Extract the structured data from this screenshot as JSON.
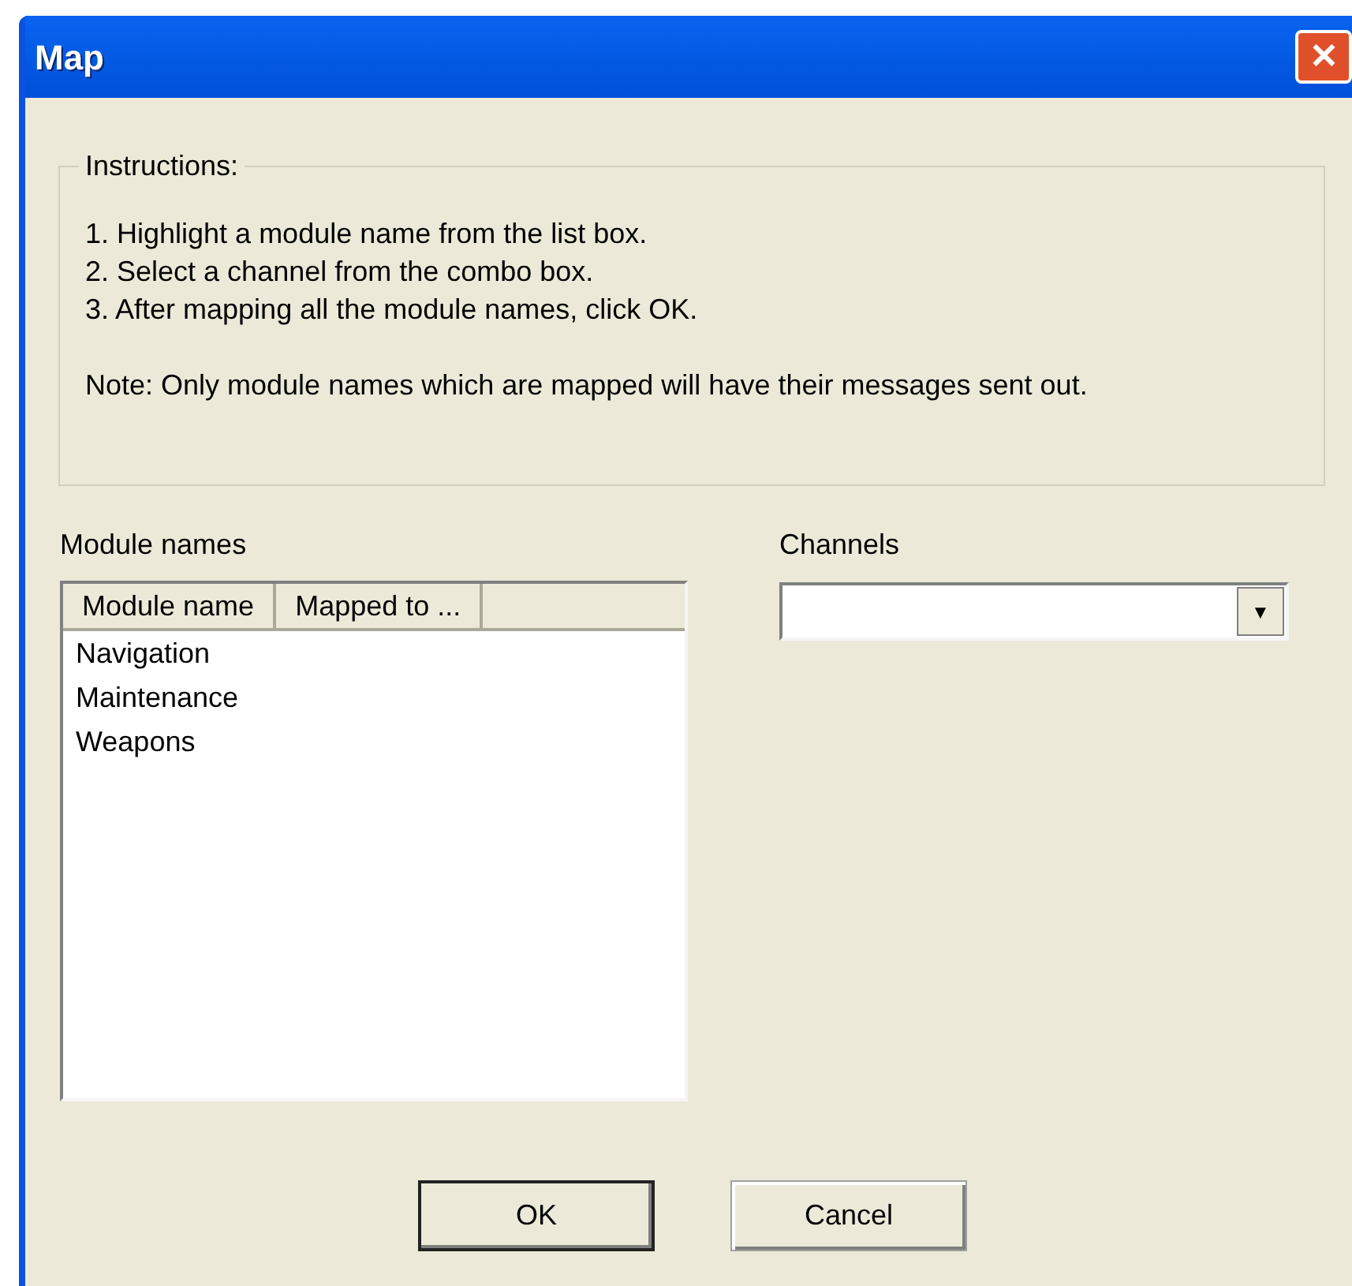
{
  "window": {
    "title": "Map",
    "close": "✕"
  },
  "instructions": {
    "legend": "Instructions:",
    "steps": [
      "1. Highlight a module name from the list box.",
      "2. Select a channel from the combo box.",
      "3. After mapping all the module names, click OK."
    ],
    "note": "Note: Only module names which are mapped will have their messages sent out."
  },
  "module_list": {
    "label": "Module names",
    "columns": [
      "Module name",
      "Mapped to ..."
    ],
    "rows": [
      "Navigation",
      "Maintenance",
      "Weapons"
    ]
  },
  "channels": {
    "label": "Channels",
    "dropdown_arrow": "▼"
  },
  "buttons": [
    {
      "label": "OK",
      "default": true
    },
    {
      "label": "Cancel",
      "default": false
    }
  ]
}
